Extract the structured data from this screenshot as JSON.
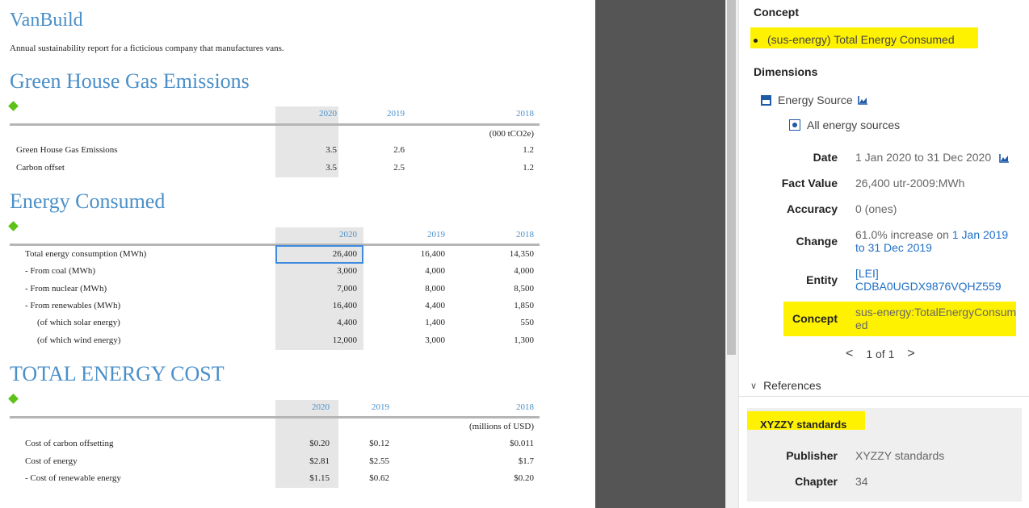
{
  "document": {
    "title": "VanBuild",
    "subtitle": "Annual sustainability report for a ficticious company that manufactures vans.",
    "sections": [
      {
        "heading": "Green House Gas Emissions",
        "years": [
          "2020",
          "2019",
          "2018"
        ],
        "unit": "(000 tCO2e)",
        "rows": [
          {
            "label": "Green House Gas Emissions",
            "values": [
              "3.5",
              "2.6",
              "1.2"
            ]
          },
          {
            "label": "Carbon offset",
            "values": [
              "3.5",
              "2.5",
              "1.2"
            ]
          }
        ]
      },
      {
        "heading": "Energy Consumed",
        "years": [
          "2020",
          "2019",
          "2018"
        ],
        "rows": [
          {
            "label": "Total energy consumption (MWh)",
            "values": [
              "26,400",
              "16,400",
              "14,350"
            ]
          },
          {
            "label": "- From coal (MWh)",
            "values": [
              "3,000",
              "4,000",
              "4,000"
            ]
          },
          {
            "label": "- From nuclear (MWh)",
            "values": [
              "7,000",
              "8,000",
              "8,500"
            ]
          },
          {
            "label": "- From renewables (MWh)",
            "values": [
              "16,400",
              "4,400",
              "1,850"
            ]
          },
          {
            "label": "(of which solar energy)",
            "values": [
              "4,400",
              "1,400",
              "550"
            ]
          },
          {
            "label": "(of which wind energy)",
            "values": [
              "12,000",
              "3,000",
              "1,300"
            ]
          }
        ]
      },
      {
        "heading": "TOTAL ENERGY COST",
        "years": [
          "2020",
          "2019",
          "2018"
        ],
        "unit": "(millions of USD)",
        "rows": [
          {
            "label": "Cost of carbon offsetting",
            "values": [
              "$0.20",
              "$0.12",
              "$0.011"
            ]
          },
          {
            "label": "Cost of energy",
            "values": [
              "$2.81",
              "$2.55",
              "$1.7"
            ]
          },
          {
            "label": "- Cost of renewable energy",
            "values": [
              "$1.15",
              "$0.62",
              "$0.20"
            ]
          }
        ]
      }
    ]
  },
  "inspector": {
    "concept_heading": "Concept",
    "concept_item": "(sus-energy) Total Energy Consumed",
    "dimensions_heading": "Dimensions",
    "dimension_name": "Energy Source",
    "dimension_member": "All energy sources",
    "fields": {
      "date_label": "Date",
      "date_value": "1 Jan 2020 to 31 Dec 2020",
      "fact_label": "Fact Value",
      "fact_value": "26,400 utr-2009:MWh",
      "accuracy_label": "Accuracy",
      "accuracy_value": "0 (ones)",
      "change_label": "Change",
      "change_prefix": "61.0% increase on ",
      "change_link": "1 Jan 2019 to 31 Dec 2019",
      "entity_label": "Entity",
      "entity_scheme": "[LEI]",
      "entity_id": "CDBA0UGDX9876VQHZ559",
      "concept_label": "Concept",
      "concept_value": "sus-energy:TotalEnergyConsumed"
    },
    "pager": {
      "prev": "<",
      "text": "1 of 1",
      "next": ">"
    },
    "references_heading": "References",
    "reference": {
      "title": "XYZZY standards",
      "publisher_label": "Publisher",
      "publisher_value": "XYZZY standards",
      "chapter_label": "Chapter",
      "chapter_value": "34"
    },
    "highlight_color": "#fff200",
    "link_color": "#1f6fc8"
  }
}
